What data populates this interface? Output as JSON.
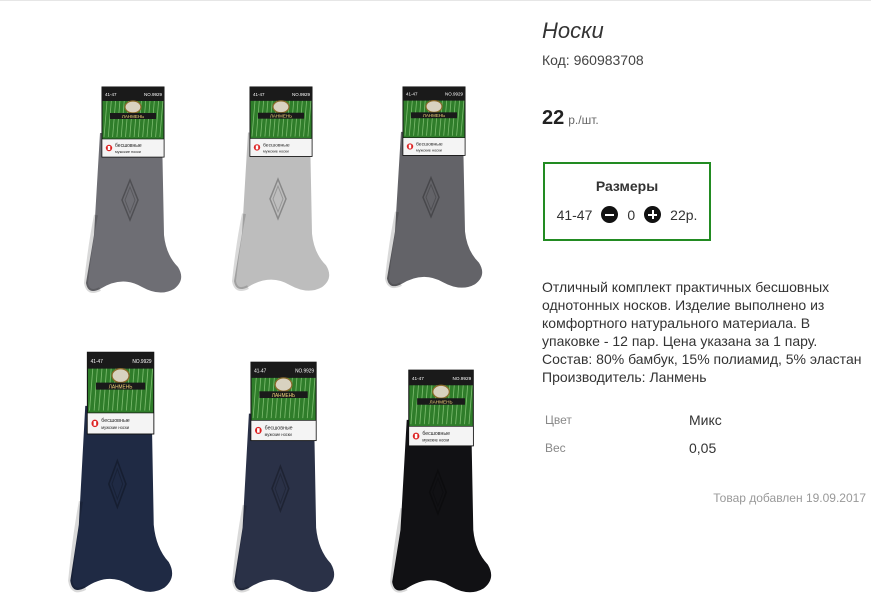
{
  "product": {
    "title": "Носки",
    "code": "Код: 960983708",
    "price": "22",
    "price_unit": "р./шт."
  },
  "sizes": {
    "title": "Размеры",
    "items": [
      {
        "size": "41-47",
        "quantity": "0",
        "price": "22р."
      }
    ]
  },
  "description": [
    "Отличный комплект практичных бесшовных",
    "однотонных носков. Изделие выполнено из",
    "комфортного натурального материала. В",
    "упаковке - 12 пар. Цена указана за 1 пару.",
    "Состав: 80% бамбук, 15% полиамид, 5% эластан",
    "Производитель: Ланмень"
  ],
  "properties": [
    {
      "label": "Цвет",
      "value": "Микс"
    },
    {
      "label": "Вес",
      "value": "0,05"
    }
  ],
  "added_date": "Товар добавлен 19.09.2017",
  "gallery": {
    "socks": [
      {
        "color": "#6e6e74",
        "label_size": "41-47",
        "label_no": "NO.9929",
        "brand": "ЛАНМЕНЬ",
        "caption1": "бесшовные",
        "caption2": "мужские носки"
      },
      {
        "color": "#bdbdbd",
        "label_size": "41-47",
        "label_no": "NO.9929",
        "brand": "ЛАНМЕНЬ",
        "caption1": "бесшовные",
        "caption2": "мужские носки"
      },
      {
        "color": "#636368",
        "label_size": "41-47",
        "label_no": "NO.9929",
        "brand": "ЛАНМЕНЬ",
        "caption1": "бесшовные",
        "caption2": "мужские носки"
      },
      {
        "color": "#1f2a44",
        "label_size": "41-47",
        "label_no": "NO.9929",
        "brand": "ЛАНМЕНЬ",
        "caption1": "бесшовные",
        "caption2": "мужские носки"
      },
      {
        "color": "#2a3147",
        "label_size": "41-47",
        "label_no": "NO.9929",
        "brand": "ЛАНМЕНЬ",
        "caption1": "бесшовные",
        "caption2": "мужские носки"
      },
      {
        "color": "#111114",
        "label_size": "41-47",
        "label_no": "NO.9929",
        "brand": "ЛАНМЕНЬ",
        "caption1": "бесшовные",
        "caption2": "мужские носки"
      }
    ]
  },
  "colors": {
    "accent_border": "#228b22",
    "label_green": "#2f7d2a",
    "label_dark": "#1a1a1a"
  }
}
